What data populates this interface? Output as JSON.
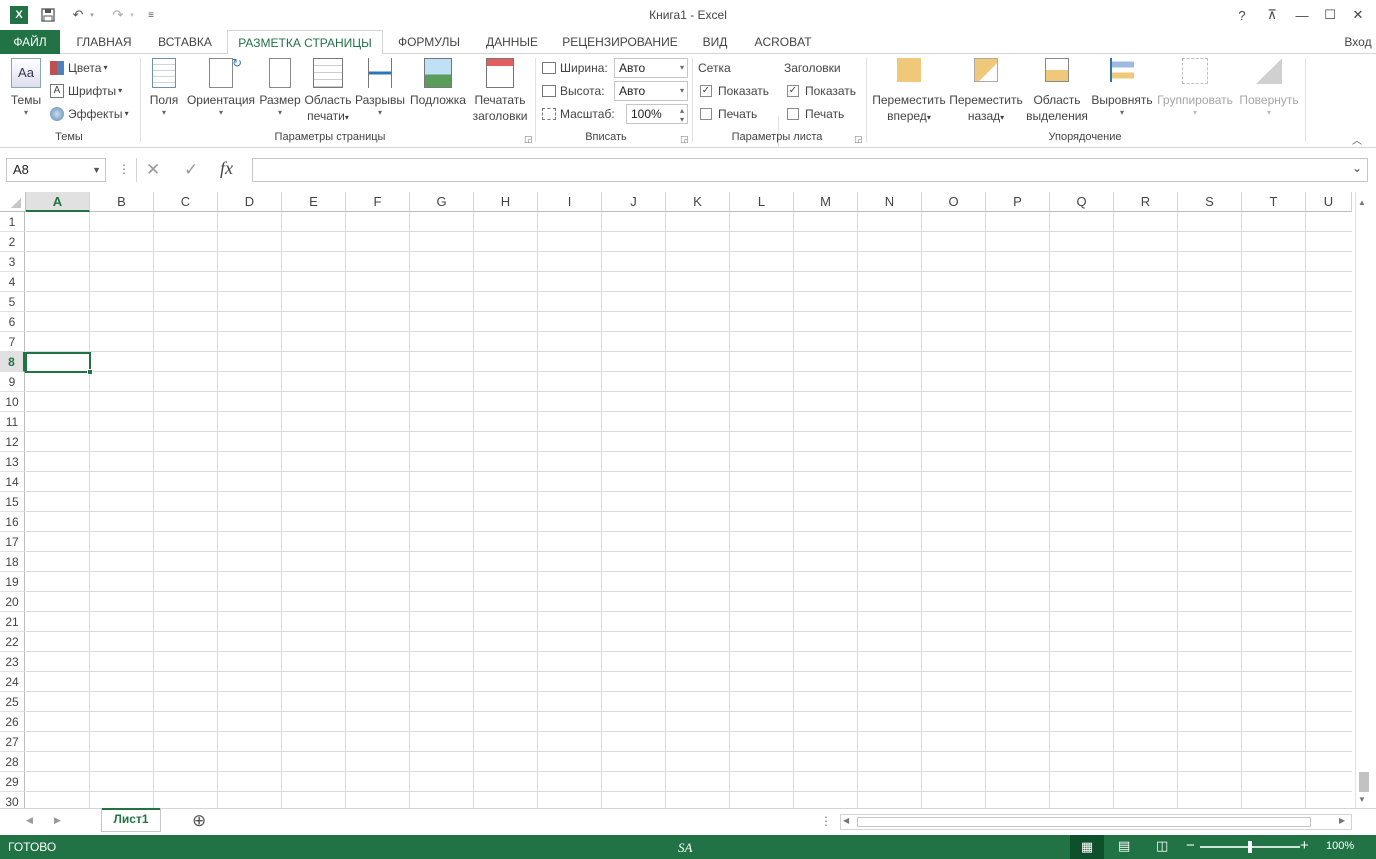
{
  "window": {
    "title": "Книга1 - Excel",
    "help": "?",
    "restore_ribbon": "⊼",
    "minimize": "—",
    "maximize": "☐",
    "close": "✕"
  },
  "qat": {
    "undo": "↶",
    "redo": "↷",
    "customize": "≡"
  },
  "tabs": [
    "ФАЙЛ",
    "ГЛАВНАЯ",
    "ВСТАВКА",
    "РАЗМЕТКА СТРАНИЦЫ",
    "ФОРМУЛЫ",
    "ДАННЫЕ",
    "РЕЦЕНЗИРОВАНИЕ",
    "ВИД",
    "ACROBAT"
  ],
  "active_tab": "РАЗМЕТКА СТРАНИЦЫ",
  "signin": "Вход",
  "ribbon": {
    "themes": {
      "label": "Темы",
      "button": "Темы",
      "colors": "Цвета",
      "fonts": "Шрифты",
      "effects": "Эффекты"
    },
    "page_setup": {
      "label": "Параметры страницы",
      "margins": "Поля",
      "orientation": "Ориентация",
      "size": "Размер",
      "print_area_1": "Область",
      "print_area_2": "печати",
      "breaks": "Разрывы",
      "background": "Подложка",
      "print_titles_1": "Печатать",
      "print_titles_2": "заголовки"
    },
    "scale": {
      "label": "Вписать",
      "width_label": "Ширина:",
      "width_value": "Авто",
      "height_label": "Высота:",
      "height_value": "Авто",
      "scale_label": "Масштаб:",
      "scale_value": "100%"
    },
    "sheet_options": {
      "label": "Параметры листа",
      "gridlines": "Сетка",
      "headings": "Заголовки",
      "view": "Показать",
      "print": "Печать",
      "gridlines_view": true,
      "gridlines_print": false,
      "headings_view": true,
      "headings_print": false
    },
    "arrange": {
      "label": "Упорядочение",
      "bring_forward_1": "Переместить",
      "bring_forward_2": "вперед",
      "send_backward_1": "Переместить",
      "send_backward_2": "назад",
      "selection_pane_1": "Область",
      "selection_pane_2": "выделения",
      "align": "Выровнять",
      "group": "Группировать",
      "rotate": "Повернуть"
    }
  },
  "formula_bar": {
    "name_box": "A8",
    "cancel": "✕",
    "enter": "✓",
    "fx": "fx",
    "value": ""
  },
  "grid": {
    "columns": [
      "A",
      "B",
      "C",
      "D",
      "E",
      "F",
      "G",
      "H",
      "I",
      "J",
      "K",
      "L",
      "M",
      "N",
      "O",
      "P",
      "Q",
      "R",
      "S",
      "T",
      "U"
    ],
    "rows": [
      "1",
      "2",
      "3",
      "4",
      "5",
      "6",
      "7",
      "8",
      "9",
      "10",
      "11",
      "12",
      "13",
      "14",
      "15",
      "16",
      "17",
      "18",
      "19",
      "20",
      "21",
      "22",
      "23",
      "24",
      "25",
      "26",
      "27",
      "28",
      "29",
      "30"
    ],
    "selected_column": "A",
    "selected_row": "8"
  },
  "sheets": {
    "tabs": [
      "Лист1"
    ],
    "active": "Лист1",
    "add": "⊕"
  },
  "status": {
    "mode": "ГОТОВО",
    "watermark": "SA",
    "zoom": "100%",
    "zoom_level": 100
  },
  "colors": {
    "accent": "#217346",
    "status_bg": "#217346"
  }
}
